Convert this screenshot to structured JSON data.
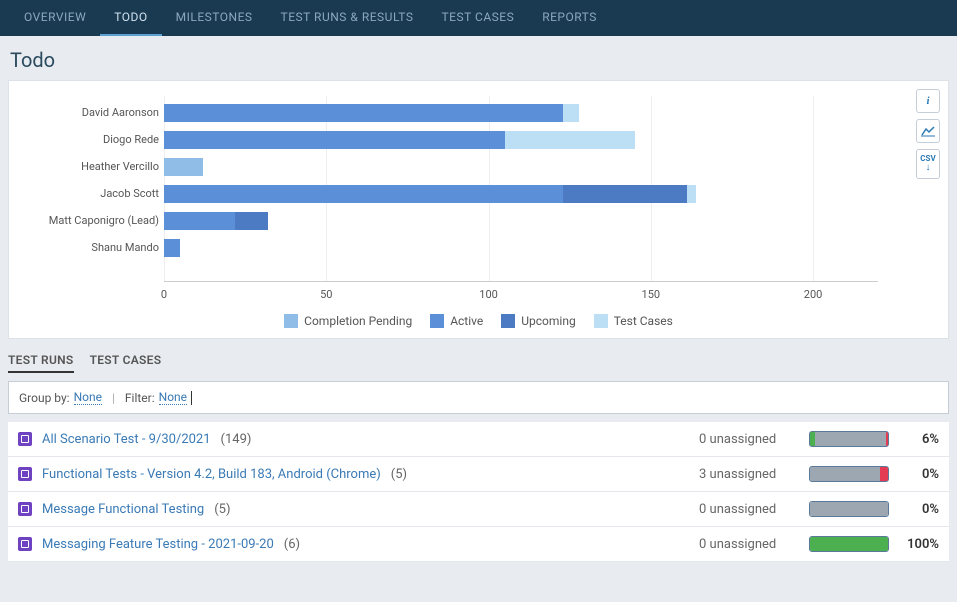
{
  "nav": {
    "items": [
      {
        "label": "OVERVIEW",
        "active": false
      },
      {
        "label": "TODO",
        "active": true
      },
      {
        "label": "MILESTONES",
        "active": false
      },
      {
        "label": "TEST RUNS & RESULTS",
        "active": false
      },
      {
        "label": "TEST CASES",
        "active": false
      },
      {
        "label": "REPORTS",
        "active": false
      }
    ]
  },
  "page_title": "Todo",
  "chart_data": {
    "type": "bar",
    "orientation": "horizontal",
    "stacked": true,
    "xlim": [
      0,
      220
    ],
    "ticks": [
      0,
      50,
      100,
      150,
      200
    ],
    "categories": [
      "David Aaronson",
      "Diogo Rede",
      "Heather Vercillo",
      "Jacob Scott",
      "Matt Caponigro (Lead)",
      "Shanu Mando"
    ],
    "series": [
      {
        "name": "Completion Pending",
        "color": "#8fbde8",
        "values": [
          0,
          0,
          12,
          0,
          0,
          0
        ]
      },
      {
        "name": "Active",
        "color": "#5b8fd8",
        "values": [
          123,
          105,
          0,
          123,
          22,
          5
        ]
      },
      {
        "name": "Upcoming",
        "color": "#4c7bc3",
        "values": [
          0,
          0,
          0,
          38,
          10,
          0
        ]
      },
      {
        "name": "Test Cases",
        "color": "#bcdff5",
        "values": [
          5,
          40,
          0,
          3,
          0,
          0
        ]
      }
    ],
    "legend": [
      "Completion Pending",
      "Active",
      "Upcoming",
      "Test Cases"
    ]
  },
  "side_actions": {
    "info": "i",
    "chart": "📈",
    "csv_label": "CSV",
    "csv_arrow": "↓"
  },
  "subtabs": {
    "items": [
      {
        "label": "TEST RUNS",
        "active": true
      },
      {
        "label": "TEST CASES",
        "active": false
      }
    ]
  },
  "filter": {
    "group_by_label": "Group by:",
    "group_by_value": "None",
    "filter_label": "Filter:",
    "filter_value": "None"
  },
  "runs": [
    {
      "name": "All Scenario Test - 9/30/2021",
      "count": "(149)",
      "unassigned": "0 unassigned",
      "pct": "6%",
      "bar": [
        {
          "color": "#4caf50",
          "w": 6
        },
        {
          "color": "#9ca7b2",
          "w": 92
        },
        {
          "color": "#e53b52",
          "w": 2
        }
      ]
    },
    {
      "name": "Functional Tests - Version 4.2, Build 183, Android (Chrome)",
      "count": "(5)",
      "unassigned": "3 unassigned",
      "pct": "0%",
      "bar": [
        {
          "color": "#9ca7b2",
          "w": 90
        },
        {
          "color": "#e53b52",
          "w": 10
        }
      ]
    },
    {
      "name": "Message Functional Testing",
      "count": "(5)",
      "unassigned": "0 unassigned",
      "pct": "0%",
      "bar": [
        {
          "color": "#9ca7b2",
          "w": 100
        }
      ]
    },
    {
      "name": "Messaging Feature Testing - 2021-09-20",
      "count": "(6)",
      "unassigned": "0 unassigned",
      "pct": "100%",
      "bar": [
        {
          "color": "#4caf50",
          "w": 100
        }
      ]
    }
  ]
}
